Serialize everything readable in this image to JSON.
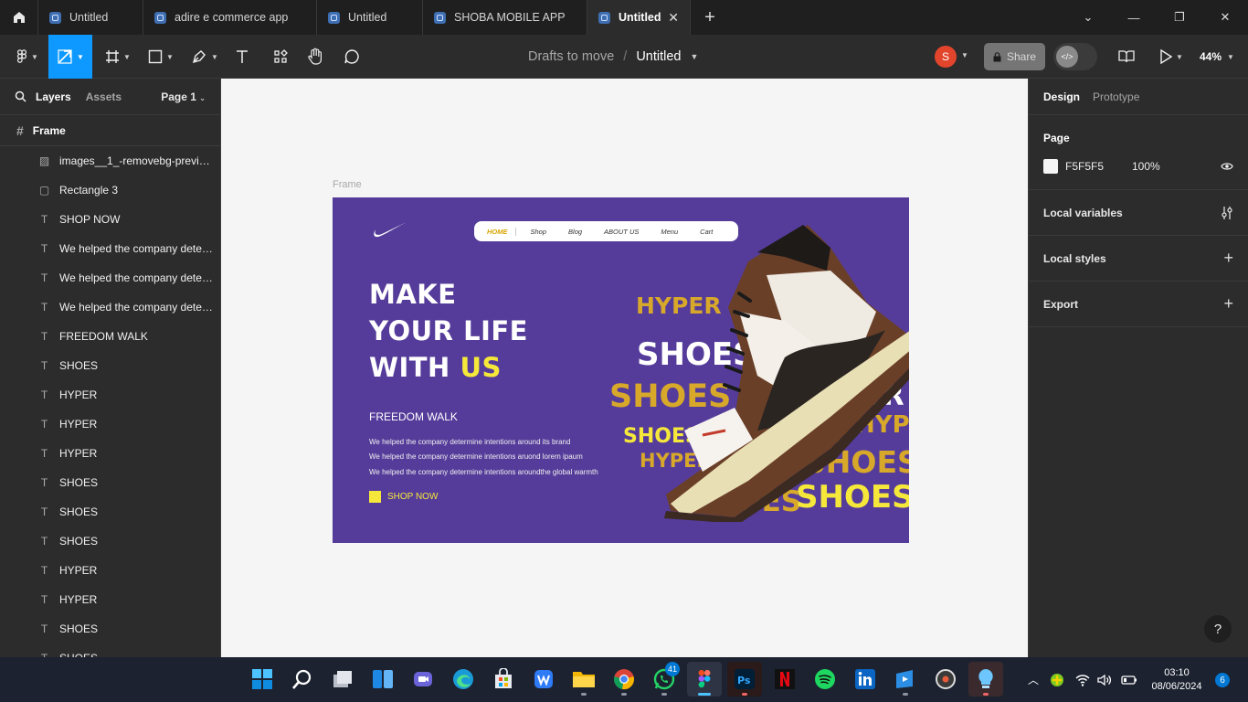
{
  "tabs": [
    {
      "label": "Untitled"
    },
    {
      "label": "adire e commerce app"
    },
    {
      "label": "Untitled"
    },
    {
      "label": "SHOBA MOBILE APP"
    },
    {
      "label": "Untitled",
      "active": true
    }
  ],
  "toolbar": {
    "breadcrumb_project": "Drafts to move",
    "breadcrumb_sep": "/",
    "breadcrumb_file": "Untitled",
    "avatar_initial": "S",
    "share_label": "Share",
    "zoom": "44%"
  },
  "layers_panel": {
    "tab_layers": "Layers",
    "tab_assets": "Assets",
    "page_selector": "Page 1",
    "frame_name": "Frame",
    "items": [
      {
        "type": "image",
        "name": "images__1_-removebg-preview"
      },
      {
        "type": "rect",
        "name": "Rectangle 3"
      },
      {
        "type": "text",
        "name": "SHOP NOW"
      },
      {
        "type": "text",
        "name": "We helped the company determine intentions around its brand"
      },
      {
        "type": "text",
        "name": "We helped the company determine intentions aruond lorem ipaum"
      },
      {
        "type": "text",
        "name": "We helped the company determine intentions aroundthe global warmth"
      },
      {
        "type": "text",
        "name": "FREEDOM WALK"
      },
      {
        "type": "text",
        "name": "SHOES"
      },
      {
        "type": "text",
        "name": "HYPER"
      },
      {
        "type": "text",
        "name": "HYPER"
      },
      {
        "type": "text",
        "name": "HYPER"
      },
      {
        "type": "text",
        "name": "SHOES"
      },
      {
        "type": "text",
        "name": "SHOES"
      },
      {
        "type": "text",
        "name": "SHOES"
      },
      {
        "type": "text",
        "name": "HYPER"
      },
      {
        "type": "text",
        "name": "HYPER"
      },
      {
        "type": "text",
        "name": "SHOES"
      },
      {
        "type": "text",
        "name": "SHOES"
      }
    ]
  },
  "canvas": {
    "frame_label": "Frame",
    "nav": [
      "HOME",
      "Shop",
      "Blog",
      "ABOUT US",
      "Menu",
      "Cart"
    ],
    "headline_line1": "MAKE",
    "headline_line2": "YOUR LIFE",
    "headline_line3a": "WITH ",
    "headline_line3b": "US",
    "subtitle": "FREEDOM WALK",
    "body_lines": [
      "We helped the company determine intentions around its brand",
      "We helped the company determine intentions aruond lorem ipaum",
      "We helped the company determine intentions aroundthe global warmth"
    ],
    "cta": "SHOP NOW",
    "words": [
      "HYPER",
      "SHOES",
      "SHOES",
      "SHOES",
      "HYPER",
      "PER",
      "HYPE",
      "ES",
      "SHOES",
      "ER",
      "SHOES",
      "SHOES"
    ],
    "colors": {
      "frame_bg": "#553c9a",
      "accent_yellow": "#f5e83a",
      "accent_gold": "#d7a82a"
    }
  },
  "design_panel": {
    "tab_design": "Design",
    "tab_prototype": "Prototype",
    "page_title": "Page",
    "page_color": "F5F5F5",
    "page_opacity": "100%",
    "local_variables": "Local variables",
    "local_styles": "Local styles",
    "export": "Export"
  },
  "help_label": "?",
  "taskbar": {
    "whatsapp_badge": "41",
    "time": "03:10",
    "date": "08/06/2024",
    "notifications": "6"
  }
}
